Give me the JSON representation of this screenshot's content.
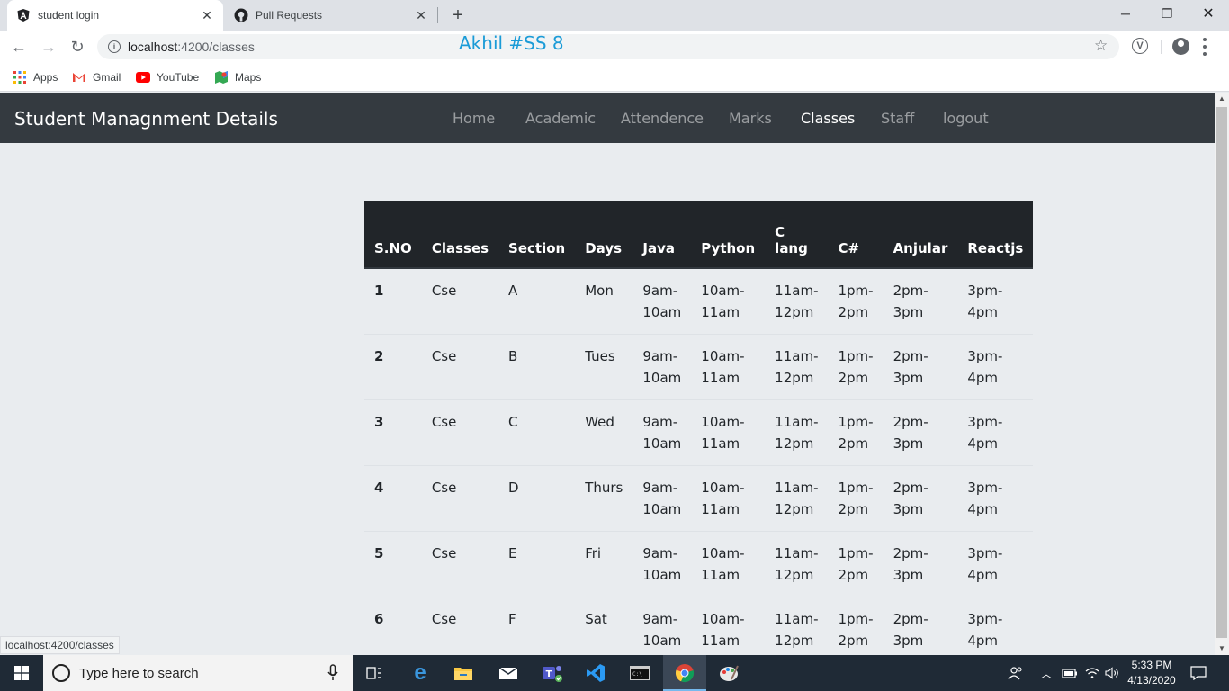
{
  "browser": {
    "tabs": [
      {
        "title": "student login",
        "icon": "angular-icon"
      },
      {
        "title": "Pull Requests",
        "icon": "github-icon"
      }
    ],
    "new_tab": "+",
    "url_host": "localhost",
    "url_path": ":4200/classes",
    "overlay_text": "Akhil #SS 8",
    "bookmarks": [
      "Apps",
      "Gmail",
      "YouTube",
      "Maps"
    ],
    "status_url": "localhost:4200/classes"
  },
  "navbar": {
    "brand": "Student Managnment Details",
    "links": [
      "Home",
      "Academic",
      "Attendence",
      "Marks",
      "Classes",
      "Staff",
      "logout"
    ],
    "active": "Classes"
  },
  "table": {
    "headers": [
      "S.NO",
      "Classes",
      "Section",
      "Days",
      "Java",
      "Python",
      "C lang",
      "C#",
      "Anjular",
      "Reactjs"
    ],
    "rows": [
      [
        "1",
        "Cse",
        "A",
        "Mon",
        "9am-10am",
        "10am-11am",
        "11am-12pm",
        "1pm-2pm",
        "2pm-3pm",
        "3pm-4pm"
      ],
      [
        "2",
        "Cse",
        "B",
        "Tues",
        "9am-10am",
        "10am-11am",
        "11am-12pm",
        "1pm-2pm",
        "2pm-3pm",
        "3pm-4pm"
      ],
      [
        "3",
        "Cse",
        "C",
        "Wed",
        "9am-10am",
        "10am-11am",
        "11am-12pm",
        "1pm-2pm",
        "2pm-3pm",
        "3pm-4pm"
      ],
      [
        "4",
        "Cse",
        "D",
        "Thurs",
        "9am-10am",
        "10am-11am",
        "11am-12pm",
        "1pm-2pm",
        "2pm-3pm",
        "3pm-4pm"
      ],
      [
        "5",
        "Cse",
        "E",
        "Fri",
        "9am-10am",
        "10am-11am",
        "11am-12pm",
        "1pm-2pm",
        "2pm-3pm",
        "3pm-4pm"
      ],
      [
        "6",
        "Cse",
        "F",
        "Sat",
        "9am-10am",
        "10am-11am",
        "11am-12pm",
        "1pm-2pm",
        "2pm-3pm",
        "3pm-4pm"
      ]
    ]
  },
  "taskbar": {
    "search_placeholder": "Type here to search",
    "time": "5:33 PM",
    "date": "4/13/2020"
  },
  "colors": {
    "navbar_bg": "#343a40",
    "table_head_bg": "#212529",
    "page_bg": "#e9ecef",
    "overlay_text": "#1a9bd7"
  }
}
